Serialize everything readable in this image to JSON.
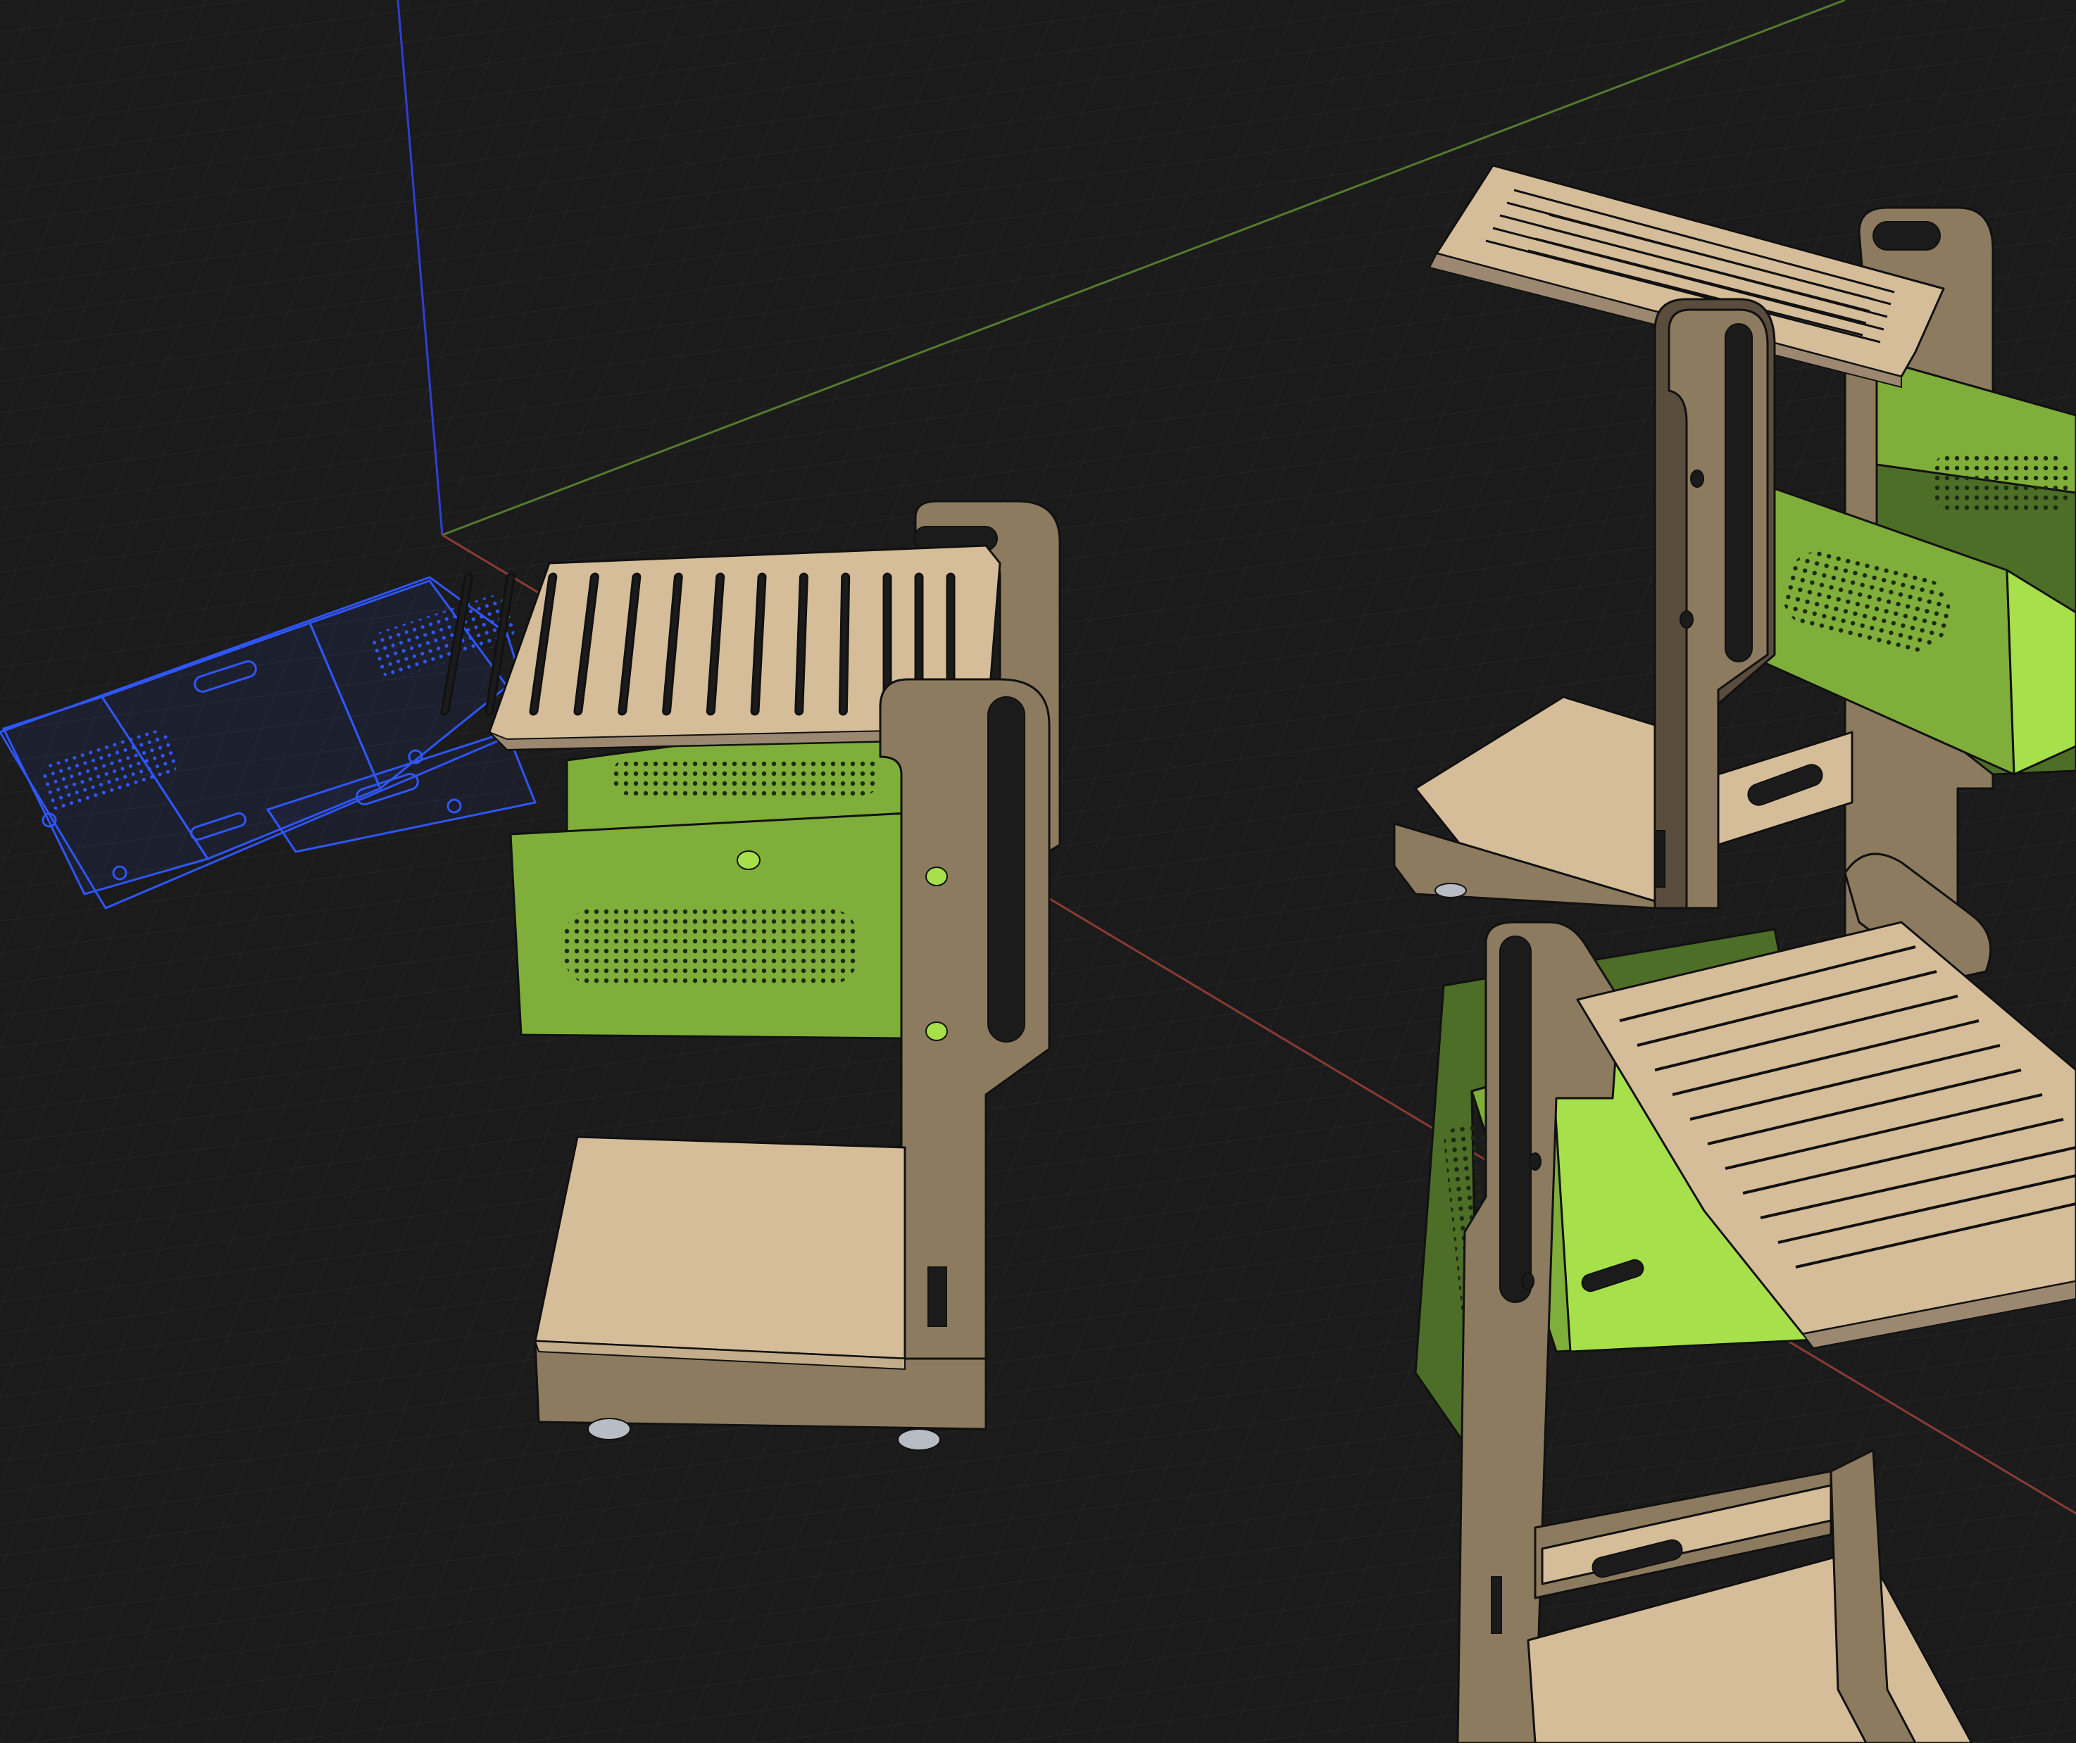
{
  "app": {
    "name": "3D CAD viewport",
    "view": "perspective"
  },
  "viewport": {
    "background_color": "#1b1b1c",
    "grid_color": "#2a2a2c",
    "grid_visible": true
  },
  "axes": {
    "x_axis_color": "#8a3b33",
    "y_axis_color": "#557a2e",
    "z_axis_color": "#2f3fd6"
  },
  "materials": {
    "wood_light": "#d5bd99",
    "wood_side": "#8d7b60",
    "wood_dark": "#5a4d3d",
    "panel_green": "#7fae3a",
    "panel_green_bright": "#a6e04a",
    "panel_green_dark": "#4d6e26",
    "flat_pattern_blue": "#2f56ff",
    "caster": "#b8bcc4"
  },
  "objects": [
    {
      "name": "flat-pattern-sheet",
      "kind": "sheet metal flat pattern (wireframe)"
    },
    {
      "name": "cart-assembly-center",
      "kind": "cart"
    },
    {
      "name": "cart-assembly-right-upper",
      "kind": "cart exploded view"
    },
    {
      "name": "cart-assembly-right-lower",
      "kind": "cart exploded view"
    }
  ]
}
